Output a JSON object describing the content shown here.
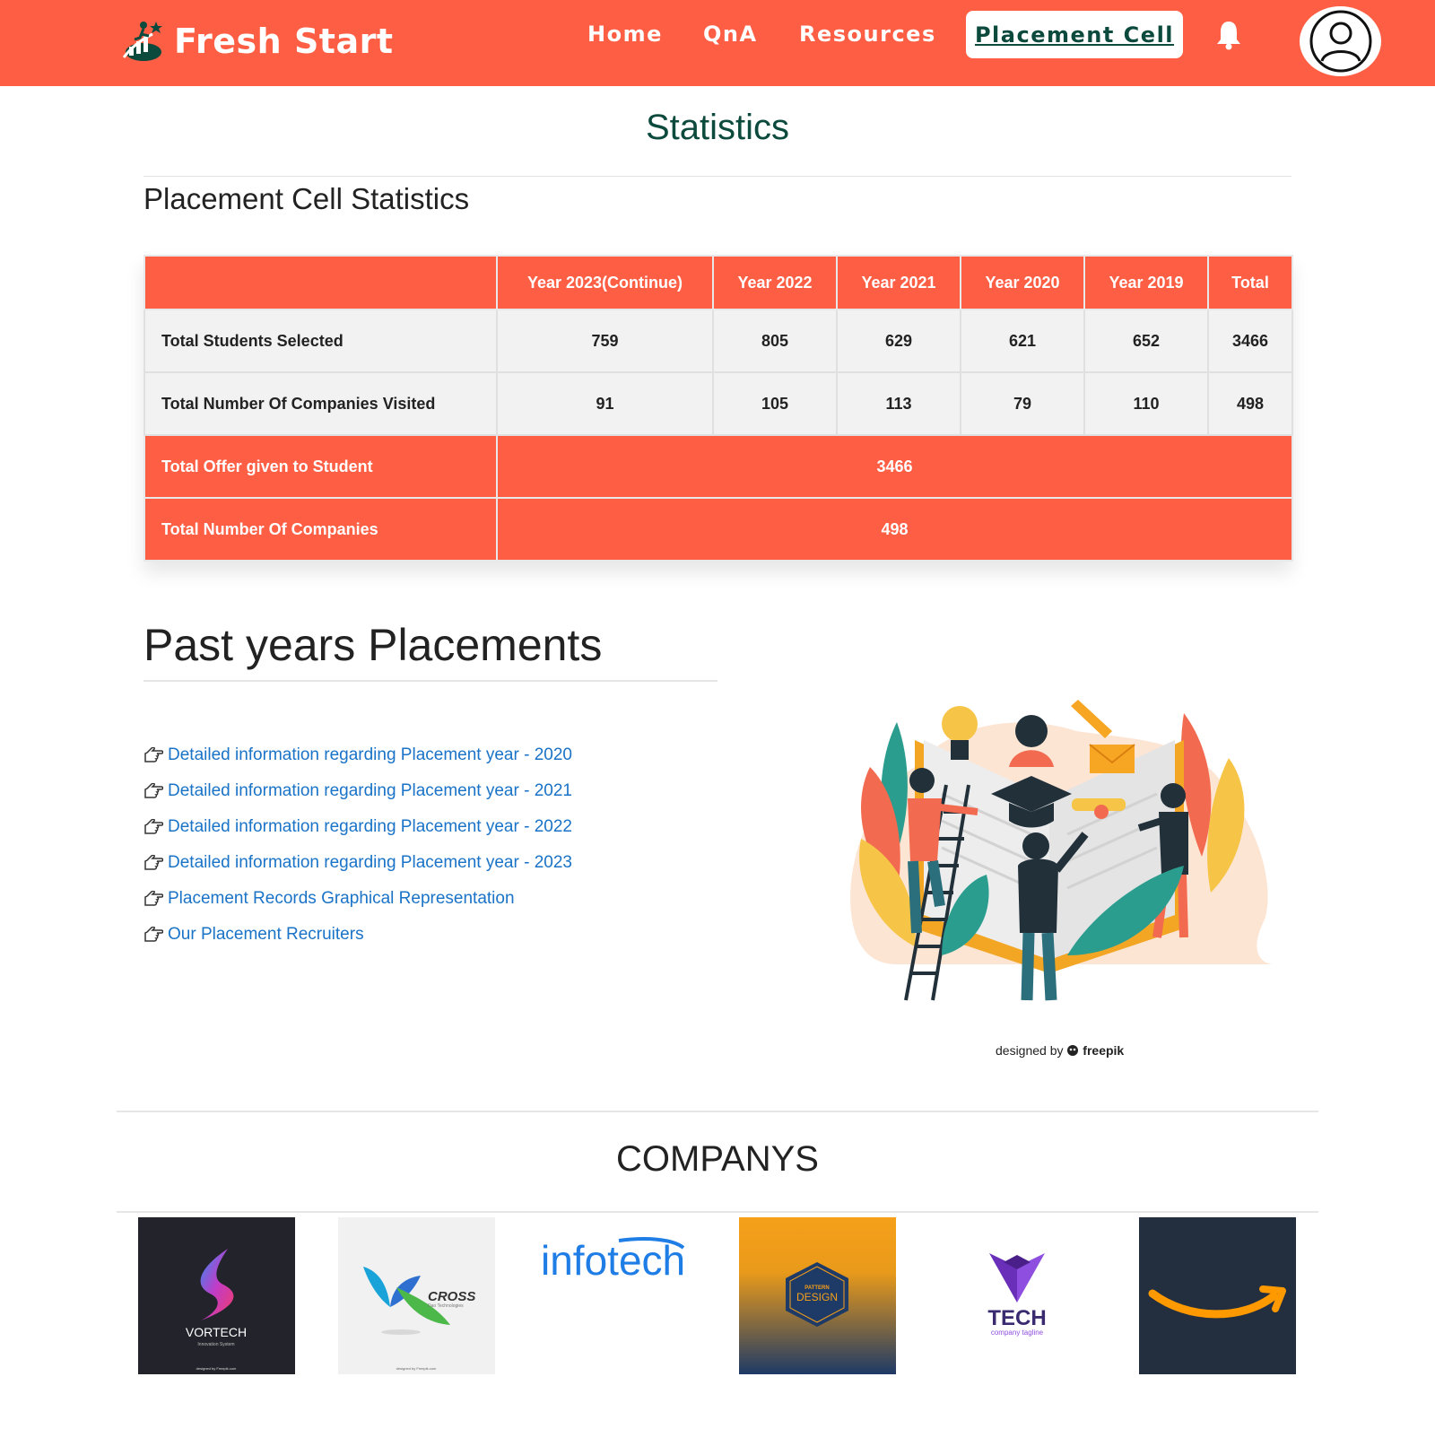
{
  "navbar": {
    "brand": "Fresh Start",
    "links": [
      "Home",
      "QnA",
      "Resources"
    ],
    "active_link": "Placement Cell",
    "bell_icon": "bell-icon",
    "avatar_icon": "user-icon",
    "bg_color": "#fd5e44"
  },
  "page": {
    "title": "Statistics",
    "subtitle": "Placement Cell Statistics"
  },
  "stats_table": {
    "headers": [
      "",
      "Year 2023(Continue)",
      "Year 2022",
      "Year 2021",
      "Year 2020",
      "Year 2019",
      "Total"
    ],
    "rows": [
      {
        "label": "Total Students Selected",
        "values": [
          "759",
          "805",
          "629",
          "621",
          "652",
          "3466"
        ]
      },
      {
        "label": "Total Number Of Companies Visited",
        "values": [
          "91",
          "105",
          "113",
          "79",
          "110",
          "498"
        ]
      }
    ],
    "summary_rows": [
      {
        "label": "Total Offer given to Student",
        "value": "3466"
      },
      {
        "label": "Total Number Of Companies",
        "value": "498"
      }
    ]
  },
  "past_placements": {
    "title": "Past years Placements",
    "links": [
      "Detailed information regarding Placement year - 2020",
      "Detailed information regarding Placement year - 2021",
      "Detailed information regarding Placement year - 2022",
      "Detailed information regarding Placement year - 2023",
      "Placement Records Graphical Representation",
      "Our Placement Recruiters"
    ],
    "credit_prefix": "designed by",
    "credit_brand": "freepik"
  },
  "companies": {
    "title": "COMPANYS",
    "logos": [
      {
        "main": "VORTECH",
        "sub": "Innovation System",
        "credit": "designed by Freepik.com"
      },
      {
        "main": "CROSS",
        "sub": "Dao Technologies",
        "credit": "designed by Freepik.com"
      },
      {
        "main": "infotech"
      },
      {
        "main": "DESIGN",
        "sub": "PATTERN"
      },
      {
        "main": "TECH",
        "sub": "company tagline"
      },
      {
        "main": ""
      }
    ]
  }
}
